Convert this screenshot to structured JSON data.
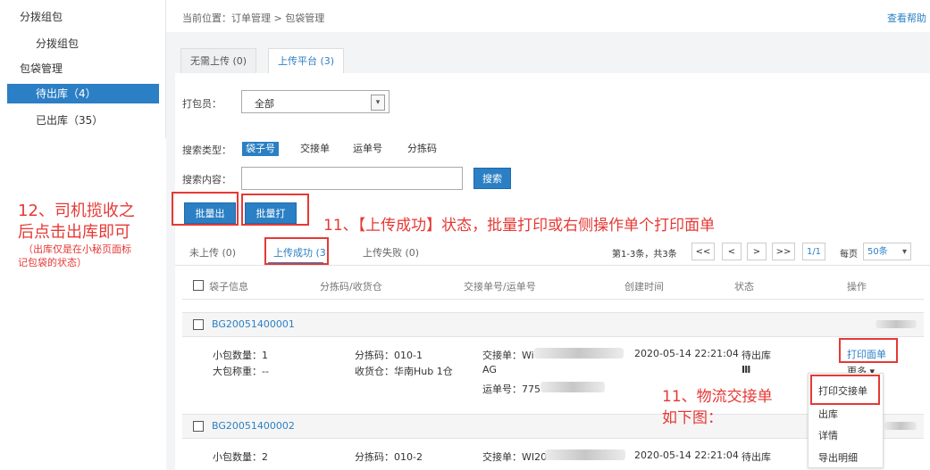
{
  "sidebar": {
    "items": [
      {
        "label": "分拨组包"
      },
      {
        "label": "分拨组包"
      },
      {
        "label": "包袋管理"
      },
      {
        "label": "待出库（4）"
      },
      {
        "label": "已出库（35）"
      }
    ]
  },
  "header": {
    "breadcrumb": "当前位置：订单管理 > 包袋管理",
    "help": "查看帮助"
  },
  "tabs": [
    {
      "label": "无需上传 (0)"
    },
    {
      "label": "上传平台 (3)"
    }
  ],
  "filters": {
    "packer_label": "打包员：",
    "packer_value": "全部",
    "search_type_label": "搜索类型：",
    "search_types": [
      "袋子号",
      "交接单",
      "运单号",
      "分拣码"
    ],
    "search_content_label": "搜索内容：",
    "search_button": "搜索"
  },
  "actions": {
    "batch_out": "批量出库",
    "batch_print": "批量打印"
  },
  "subtabs": [
    {
      "label": "未上传 (0)"
    },
    {
      "label": "上传成功 (3"
    },
    {
      "label": "上传失败 (0)"
    }
  ],
  "pager": {
    "summary": "第1-3条，共3条",
    "first": "<<",
    "prev": "<",
    "next": ">",
    "last": ">>",
    "page": "1/1",
    "per_page_label": "每页",
    "per_page_value": "50条"
  },
  "table": {
    "headers": [
      "袋子信息",
      "分拣码/收货仓",
      "交接单号/运单号",
      "创建时间",
      "状态",
      "操作"
    ],
    "rows": [
      {
        "id": "BG20051400001",
        "small_count": "小包数量：1",
        "big_weight": "大包称重：--",
        "sort_code": "分拣码：010-1",
        "warehouse": "收货仓：华南Hub 1仓",
        "handover": "交接单：Wi",
        "handover_cont": "AG",
        "waybill": "运单号：775",
        "created": "2020-05-14 22:21:04",
        "status": "待出库",
        "status_icon": "Ⅲ",
        "op_print": "打印面单",
        "op_more": "更多"
      },
      {
        "id": "BG20051400002",
        "small_count": "小包数量：2",
        "sort_code": "分拣码：010-2",
        "handover": "交接单：WI20",
        "created": "2020-05-14 22:21:04",
        "status": "待出库"
      }
    ]
  },
  "more_menu": {
    "items": [
      "打印交接单",
      "出库",
      "详情",
      "导出明细"
    ]
  },
  "annotations": {
    "a11_top": "11、【上传成功】状态，批量打印或右侧操作单个打印面单",
    "a12_line1": "12、司机揽收之",
    "a12_line2": "后点击出库即可",
    "a12_note1": "（出库仅是在小秘页面标",
    "a12_note2": "记包袋的状态）",
    "a11_bottom_line1": "11、物流交接单",
    "a11_bottom_line2": "如下图："
  },
  "colors": {
    "accent": "#2b7fc4",
    "annotation": "#e53935"
  }
}
